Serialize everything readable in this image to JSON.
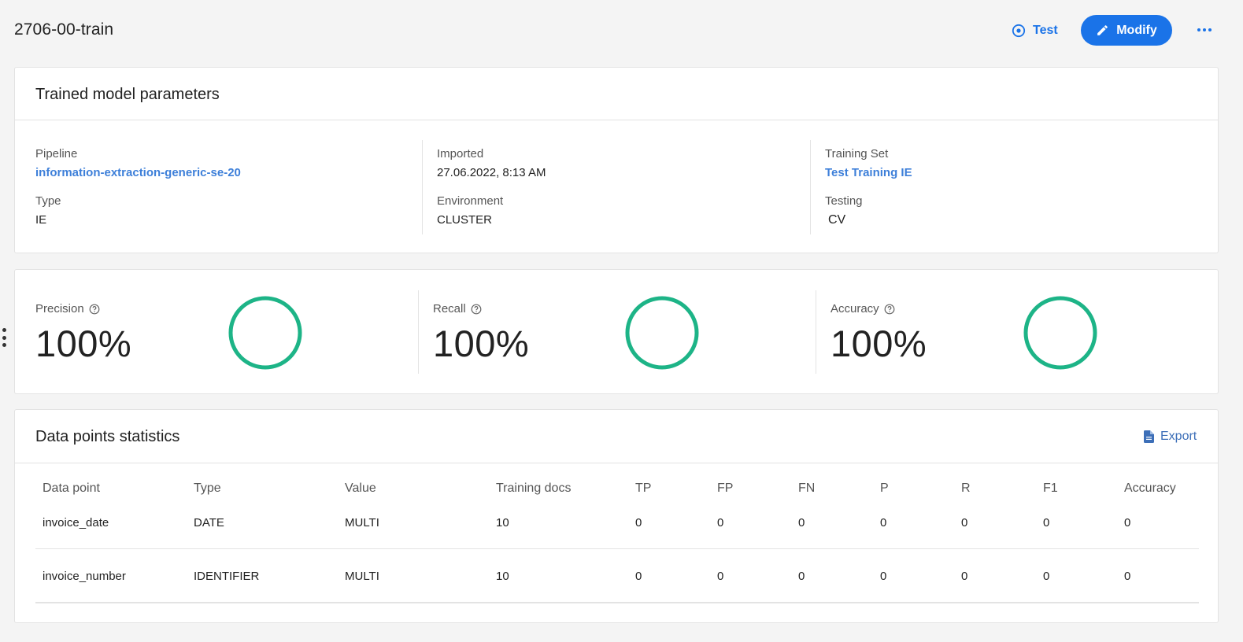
{
  "header": {
    "title": "2706-00-train",
    "test_label": "Test",
    "modify_label": "Modify"
  },
  "params": {
    "title": "Trained model parameters",
    "pipeline_label": "Pipeline",
    "pipeline_value": "information-extraction-generic-se-20",
    "type_label": "Type",
    "type_value": "IE",
    "imported_label": "Imported",
    "imported_value": "27.06.2022, 8:13 AM",
    "environment_label": "Environment",
    "environment_value": "CLUSTER",
    "training_set_label": "Training Set",
    "training_set_value": "Test Training IE",
    "testing_label": "Testing",
    "testing_value": "CV"
  },
  "metrics": [
    {
      "label": "Precision",
      "value": "100%",
      "fraction": 1.0
    },
    {
      "label": "Recall",
      "value": "100%",
      "fraction": 1.0
    },
    {
      "label": "Accuracy",
      "value": "100%",
      "fraction": 1.0
    }
  ],
  "stats": {
    "title": "Data points statistics",
    "export_label": "Export",
    "columns": [
      "Data point",
      "Type",
      "Value",
      "Training docs",
      "TP",
      "FP",
      "FN",
      "P",
      "R",
      "F1",
      "Accuracy"
    ],
    "rows": [
      [
        "invoice_date",
        "DATE",
        "MULTI",
        "10",
        "0",
        "0",
        "0",
        "0",
        "0",
        "0",
        "0"
      ],
      [
        "invoice_number",
        "IDENTIFIER",
        "MULTI",
        "10",
        "0",
        "0",
        "0",
        "0",
        "0",
        "0",
        "0"
      ]
    ]
  },
  "colors": {
    "primary": "#1a73e8",
    "link": "#3d7fd9",
    "ring": "#1db487",
    "background": "#f4f4f4"
  }
}
